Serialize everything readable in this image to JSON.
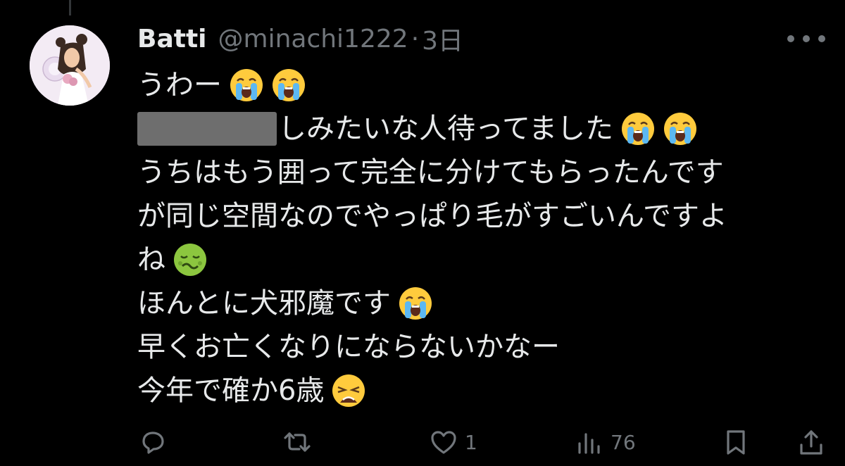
{
  "tweet": {
    "display_name": "Batti",
    "handle": "@minachi1222",
    "separator": "·",
    "timestamp": "3日",
    "lines": [
      "うわー",
      "しみたいな人待ってました",
      "うちはもう囲って完全に分けてもらったんです",
      "が同じ空間なのでやっぱり毛がすごいんですよ",
      "ね",
      "ほんとに犬邪魔です",
      "早くお亡くなりにならないかなー",
      "今年で確か6歳"
    ]
  },
  "actions": {
    "reply_count": "",
    "retweet_count": "",
    "like_count": "1",
    "views_count": "76"
  },
  "colors": {
    "background": "#000000",
    "text": "#e7e9ea",
    "muted": "#71767b"
  },
  "icons": [
    "more-icon",
    "crying-emoji",
    "nauseated-emoji",
    "weary-emoji",
    "reply-icon",
    "retweet-icon",
    "like-icon",
    "views-icon",
    "bookmark-icon",
    "share-icon"
  ]
}
